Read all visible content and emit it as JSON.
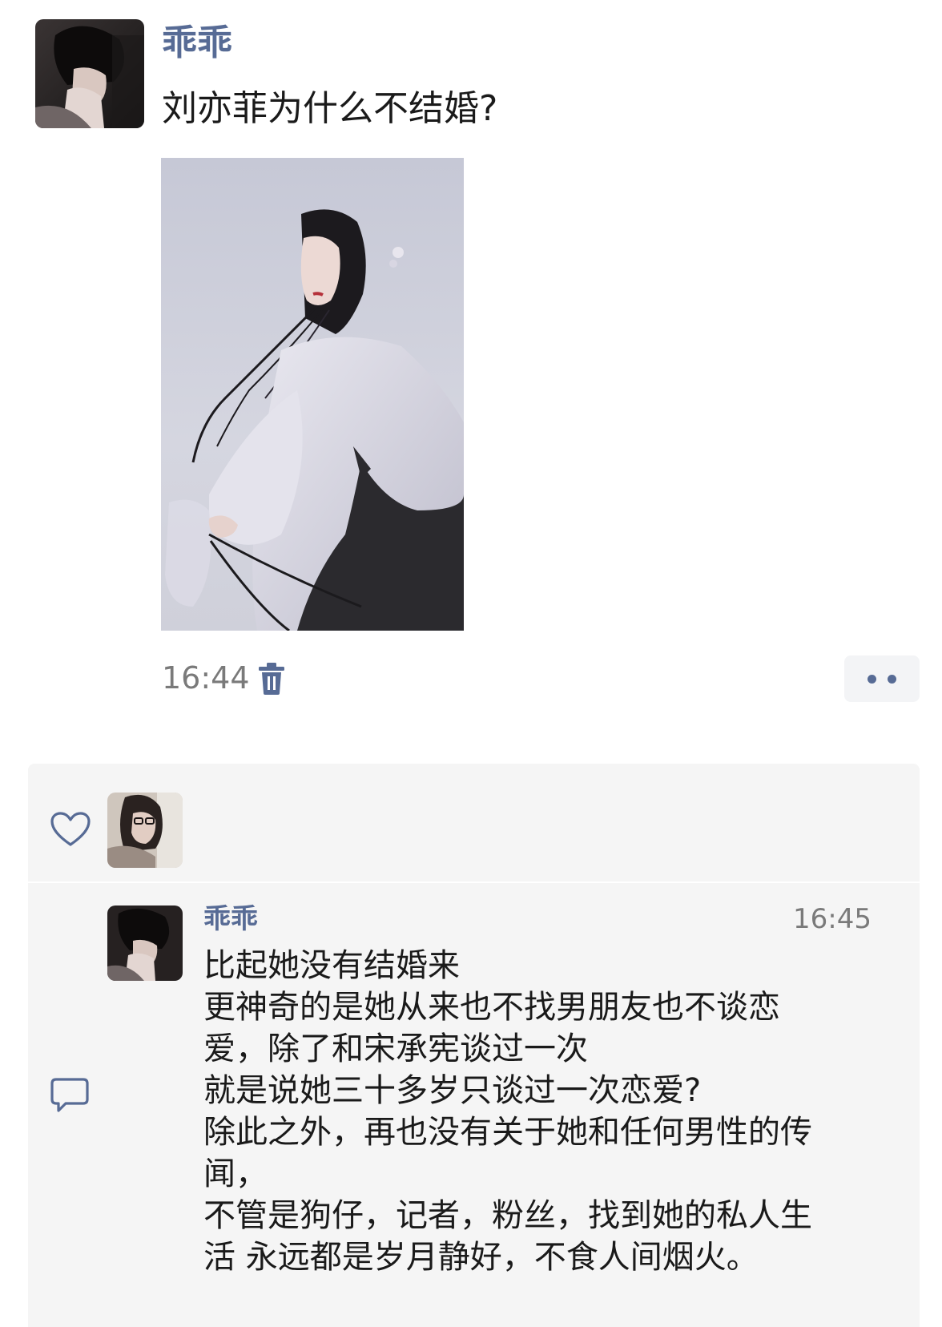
{
  "post": {
    "author": "乖乖",
    "text": "刘亦菲为什么不结婚?",
    "time": "16:44",
    "icons": {
      "avatar": "hooded-person-avatar",
      "image": "woman-on-horse-photo",
      "delete": "trash-icon",
      "more": "more-dots-icon"
    }
  },
  "interactions": {
    "like_icon": "heart-icon",
    "comment_icon": "comment-bubble-icon",
    "liker_avatar": "woman-with-glasses-avatar",
    "comment": {
      "author": "乖乖",
      "time": "16:45",
      "lines": [
        "比起她没有结婚来",
        "更神奇的是她从来也不找男朋友也不谈恋",
        "爱，除了和宋承宪谈过一次",
        "就是说她三十多岁只谈过一次恋爱?",
        "除此之外，再也没有关于她和任何男性的传",
        "闻，",
        "不管是狗仔，记者，粉丝，找到她的私人生",
        "活 永远都是岁月静好，不食人间烟火。"
      ]
    }
  },
  "colors": {
    "link_blue": "#576b95",
    "text": "#1a1a1a",
    "muted": "#7a7a7a",
    "panel_bg": "#f5f5f5"
  }
}
